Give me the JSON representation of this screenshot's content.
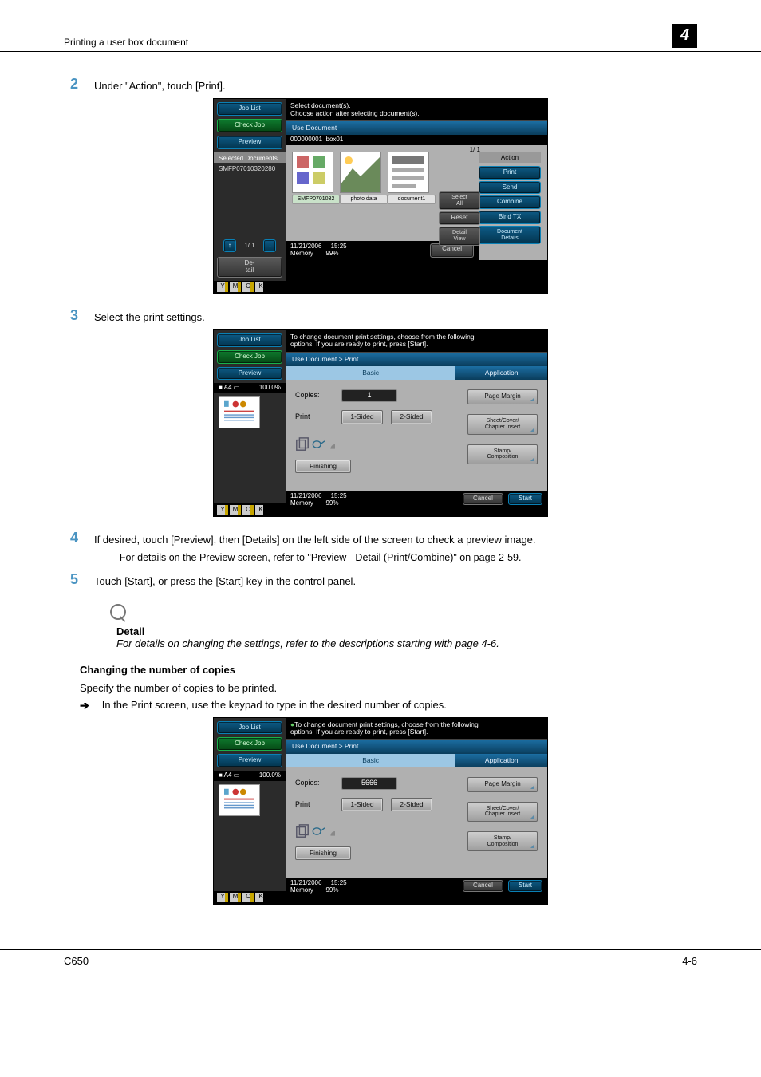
{
  "header": {
    "breadcrumb": "Printing a user box document",
    "chapter": "4"
  },
  "footer": {
    "left": "C650",
    "right": "4-6"
  },
  "steps": {
    "s2": {
      "num": "2",
      "text": "Under \"Action\", touch [Print]."
    },
    "s3": {
      "num": "3",
      "text": "Select the print settings."
    },
    "s4": {
      "num": "4",
      "text": "If desired, touch [Preview], then [Details] on the left side of the screen to check a preview image.",
      "sub": "For details on the Preview screen, refer to \"Preview - Detail (Print/Combine)\" on page 2-59."
    },
    "s5": {
      "num": "5",
      "text": "Touch [Start], or press the [Start] key in the control panel."
    }
  },
  "detail": {
    "head": "Detail",
    "body": "For details on changing the settings, refer to the descriptions starting with page 4-6."
  },
  "section_copies": {
    "title": "Changing the number of copies",
    "intro": "Specify the number of copies to be printed.",
    "arrow": "In the Print screen, use the keypad to type in the desired number of copies."
  },
  "toner_letters": [
    "Y",
    "M",
    "C",
    "K"
  ],
  "status": {
    "date": "11/21/2006",
    "time": "15:25",
    "mem_label": "Memory",
    "mem_val": "99%"
  },
  "panel1": {
    "msg1": "Select document(s).",
    "msg2": "Choose action after selecting document(s).",
    "job_list": "Job List",
    "check_job": "Check Job",
    "preview": "Preview",
    "sel_docs_label": "Selected Documents",
    "sel_doc": "SMFP07010320280",
    "page_nav": "1/  1",
    "detail_btn": "De-\ntail",
    "bluebar": "Use Document",
    "box_id": "000000001",
    "box_name": "box01",
    "thumbs": [
      "SMFP0701032",
      "photo data",
      "document1"
    ],
    "page_info": "1/  1",
    "right": {
      "header": "Action",
      "print": "Print",
      "send": "Send",
      "combine": "Combine",
      "bindtx": "Bind TX",
      "docdetails": "Document\nDetails"
    },
    "below_right": {
      "select_all": "Select\nAll",
      "reset": "Reset",
      "detail_view": "Detail\nView"
    },
    "cancel": "Cancel"
  },
  "panel2": {
    "msg1": "To change document print settings, choose from the following",
    "msg2": "options. If you are ready to print, press [Start].",
    "job_list": "Job List",
    "check_job": "Check Job",
    "preview": "Preview",
    "paper": "A4",
    "zoom": "100.0%",
    "bluebar": "Use Document > Print",
    "tab_basic": "Basic",
    "tab_app": "Application",
    "copies_label": "Copies:",
    "copies_val": "1",
    "print_label": "Print",
    "onesided": "1-Sided",
    "twosided": "2-Sided",
    "finishing": "Finishing",
    "right": {
      "page_margin": "Page Margin",
      "sheet": "Sheet/Cover/\nChapter Insert",
      "stamp": "Stamp/\nComposition"
    },
    "cancel": "Cancel",
    "start": "Start"
  },
  "panel3": {
    "copies_val": "5666"
  }
}
